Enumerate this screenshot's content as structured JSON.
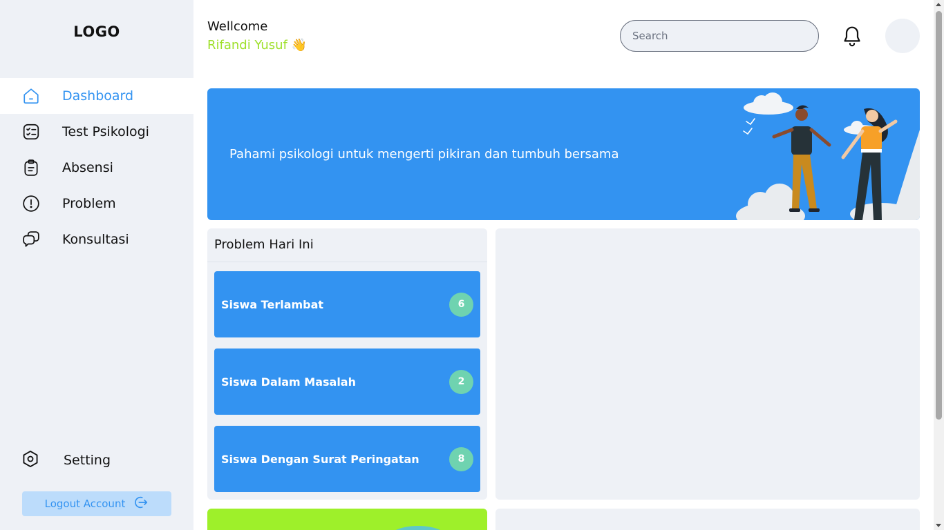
{
  "sidebar": {
    "logo": "LOGO",
    "items": [
      {
        "label": "Dashboard",
        "icon": "home-icon",
        "active": true
      },
      {
        "label": "Test Psikologi",
        "icon": "checklist-icon",
        "active": false
      },
      {
        "label": "Absensi",
        "icon": "clipboard-icon",
        "active": false
      },
      {
        "label": "Problem",
        "icon": "alert-circle-icon",
        "active": false
      },
      {
        "label": "Konsultasi",
        "icon": "chat-icon",
        "active": false
      }
    ],
    "setting": {
      "label": "Setting",
      "icon": "hexagon-gear-icon"
    },
    "logout": {
      "label": "Logout Account",
      "icon": "logout-icon"
    }
  },
  "header": {
    "greeting": "Wellcome",
    "username": "Rifandi Yusuf 👋",
    "search_placeholder": "Search",
    "notification_icon": "bell-icon"
  },
  "banner": {
    "text": "Pahami psikologi untuk mengerti pikiran dan tumbuh bersama"
  },
  "problem_card": {
    "title": "Problem Hari Ini",
    "items": [
      {
        "label": "Siswa Terlambat",
        "count": "6"
      },
      {
        "label": "Siswa Dalam Masalah",
        "count": "2"
      },
      {
        "label": "Siswa Dengan Surat Peringatan",
        "count": "8"
      }
    ]
  },
  "colors": {
    "primary": "#3393f1",
    "accent_green": "#9ee02a",
    "badge": "#6fd3b0",
    "sidebar_bg": "#eef1f6",
    "logout_bg": "#bcdcfb"
  }
}
